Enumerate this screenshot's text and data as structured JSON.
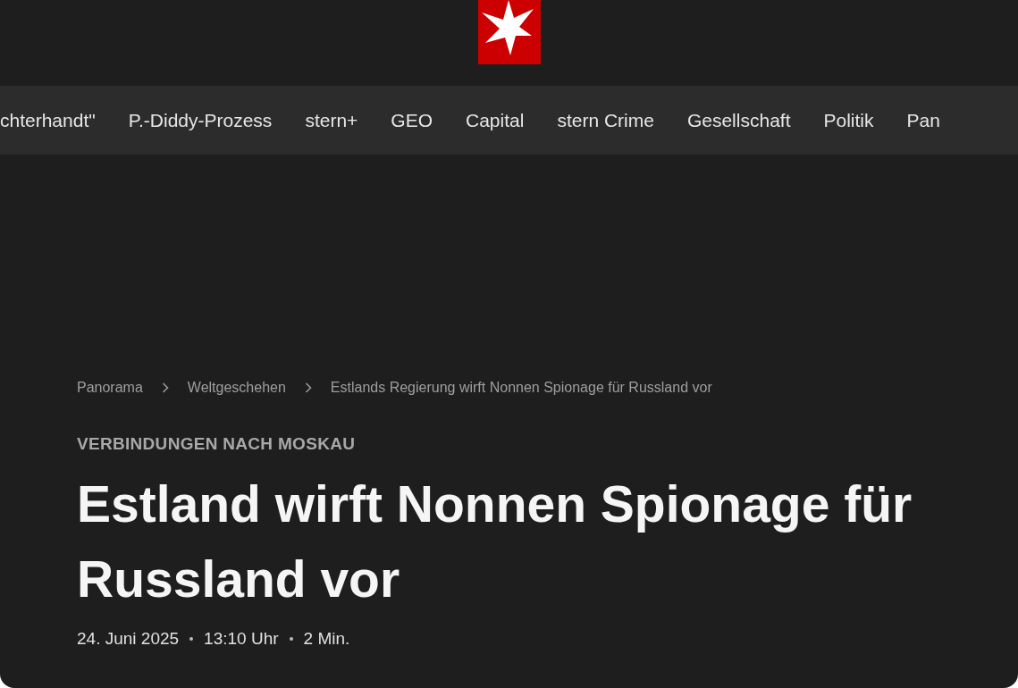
{
  "nav": {
    "items": [
      {
        "label": "chterhandt\""
      },
      {
        "label": "P.-Diddy-Prozess"
      },
      {
        "label": "stern+"
      },
      {
        "label": "GEO"
      },
      {
        "label": "Capital"
      },
      {
        "label": "stern Crime"
      },
      {
        "label": "Gesellschaft"
      },
      {
        "label": "Politik"
      },
      {
        "label": "Pan"
      }
    ]
  },
  "breadcrumbs": [
    "Panorama",
    "Weltgeschehen",
    "Estlands Regierung wirft Nonnen Spionage für Russland vor"
  ],
  "article": {
    "kicker": "VERBINDUNGEN NACH MOSKAU",
    "headline": "Estland wirft Nonnen Spionage für Russland vor",
    "meta": [
      "24. Juni 2025",
      "13:10 Uhr",
      "2 Min."
    ]
  }
}
